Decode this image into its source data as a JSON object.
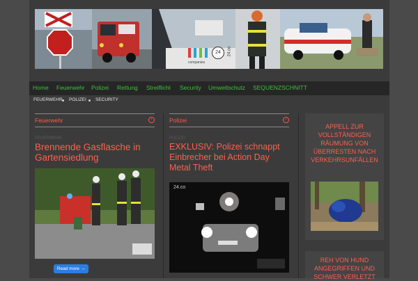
{
  "header": {
    "tiles": [
      {
        "name": "stop-sign-photo",
        "color": "#7a8ea0"
      },
      {
        "name": "fire-truck-photo",
        "color": "#b23a32"
      },
      {
        "name": "car-interior-photo",
        "color": "#3a3f45"
      },
      {
        "name": "firefighter-photo",
        "color": "#c9c9c9"
      },
      {
        "name": "police-car-photo",
        "color": "#9fb3c8"
      }
    ],
    "logo_badge": "24",
    "logo_small": "companies",
    "logo_url": "24.co"
  },
  "nav": {
    "items": [
      "Home",
      "Feuerwehr",
      "Polizei",
      "Rettung",
      "Streiflicht",
      "Security",
      "Umweltschutz",
      "SEQUENZSCHNITT"
    ]
  },
  "breadcrumbs": [
    "FEUERWEHR",
    "POLIZEI",
    "SECURITY"
  ],
  "columns": [
    {
      "heading": "Feuerwehr",
      "tag": "FEUERWEHR",
      "title": "Brennende Gasflasche in Gartensiedlung",
      "read_more": "Read more →"
    },
    {
      "heading": "Polizei",
      "tag": "POLIZEI",
      "title": "EXKLUSIV: Polizei schnappt Einbrecher bei Action Day Metal Theft",
      "watermark": "24.co"
    }
  ],
  "sidebar": [
    {
      "title": "APPELL ZUR VOLLSTÄNDIGEN RÄUMUNG VON ÜBERRESTEN NACH VERKEHRSUNFÄLLEN"
    },
    {
      "title": "REH VON HUND ANGEGRIFFEN UND SCHWER VERLETZT"
    }
  ],
  "colors": {
    "accent": "#ff5f4e",
    "nav_text": "#3fbf3f",
    "button": "#2b7de0"
  }
}
